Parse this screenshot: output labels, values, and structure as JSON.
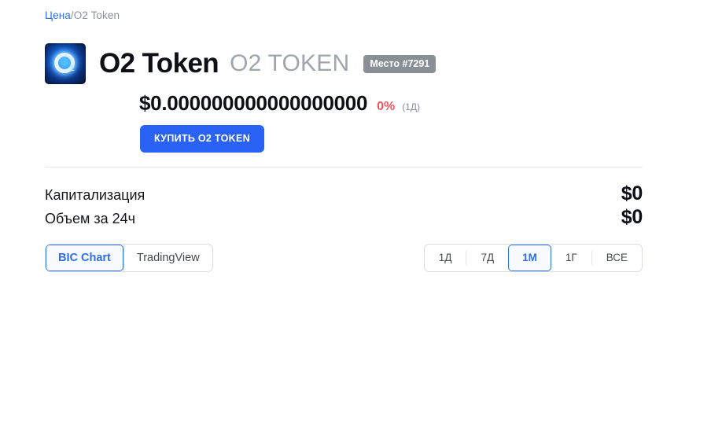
{
  "breadcrumb": {
    "link_label": "Цена",
    "separator": "/",
    "current": "O2 Token"
  },
  "token": {
    "logo_icon": "o2-token-logo-icon",
    "logo_subscript": "2",
    "name": "O2 Token",
    "symbol": "O2 TOKEN",
    "rank_badge": "Место #7291"
  },
  "price": {
    "value": "$0.000000000000000000",
    "change": "0%",
    "change_color": "#f2545b",
    "period": "(1Д)"
  },
  "buy_button": {
    "label": "КУПИТЬ O2 TOKEN",
    "color": "#2962f5"
  },
  "stats": [
    {
      "label": "Капитализация",
      "value": "$0"
    },
    {
      "label": "Объем за 24ч",
      "value": "$0"
    }
  ],
  "chart_source_tabs": [
    {
      "label": "BIC Chart",
      "active": true
    },
    {
      "label": "TradingView",
      "active": false
    }
  ],
  "time_ranges": [
    {
      "label": "1Д",
      "active": false
    },
    {
      "label": "7Д",
      "active": false
    },
    {
      "label": "1М",
      "active": true
    },
    {
      "label": "1Г",
      "active": false
    },
    {
      "label": "ВСЕ",
      "active": false
    }
  ],
  "colors": {
    "accent": "#2f6fe4",
    "brand_button": "#2962f5",
    "negative": "#f2545b",
    "muted": "#8b9099"
  }
}
